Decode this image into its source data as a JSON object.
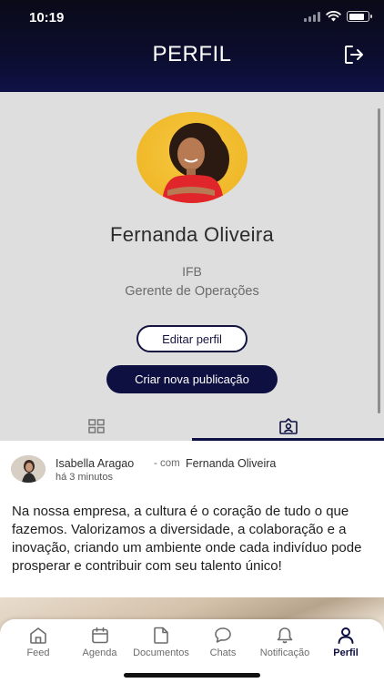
{
  "status_bar": {
    "time": "10:19"
  },
  "header": {
    "title": "PERFIL"
  },
  "profile": {
    "name": "Fernanda Oliveira",
    "company": "IFB",
    "role": "Gerente de Operações",
    "edit_button": "Editar perfil",
    "new_post_button": "Criar nova publicação",
    "tabs": [
      {
        "icon": "grid-icon",
        "active": false
      },
      {
        "icon": "tagged-person-icon",
        "active": true
      }
    ]
  },
  "post": {
    "author": "Isabella Aragao",
    "with_label": "- com",
    "tagged": "Fernanda Oliveira",
    "time": "há 3 minutos",
    "body": "Na nossa empresa, a cultura é o coração de tudo o que fazemos. Valorizamos a diversidade, a colaboração e a inovação, criando um ambiente onde cada indivíduo pode prosperar e contribuir com seu talento único!"
  },
  "bottom_nav": {
    "items": [
      {
        "label": "Feed",
        "icon": "home-icon",
        "active": false
      },
      {
        "label": "Agenda",
        "icon": "calendar-icon",
        "active": false
      },
      {
        "label": "Documentos",
        "icon": "document-icon",
        "active": false
      },
      {
        "label": "Chats",
        "icon": "chat-icon",
        "active": false
      },
      {
        "label": "Notificação",
        "icon": "bell-icon",
        "active": false
      },
      {
        "label": "Perfil",
        "icon": "profile-icon",
        "active": true
      }
    ]
  },
  "colors": {
    "accent": "#0f1042",
    "avatar_bg": "#f0b92a",
    "profile_bg": "#dedede"
  }
}
